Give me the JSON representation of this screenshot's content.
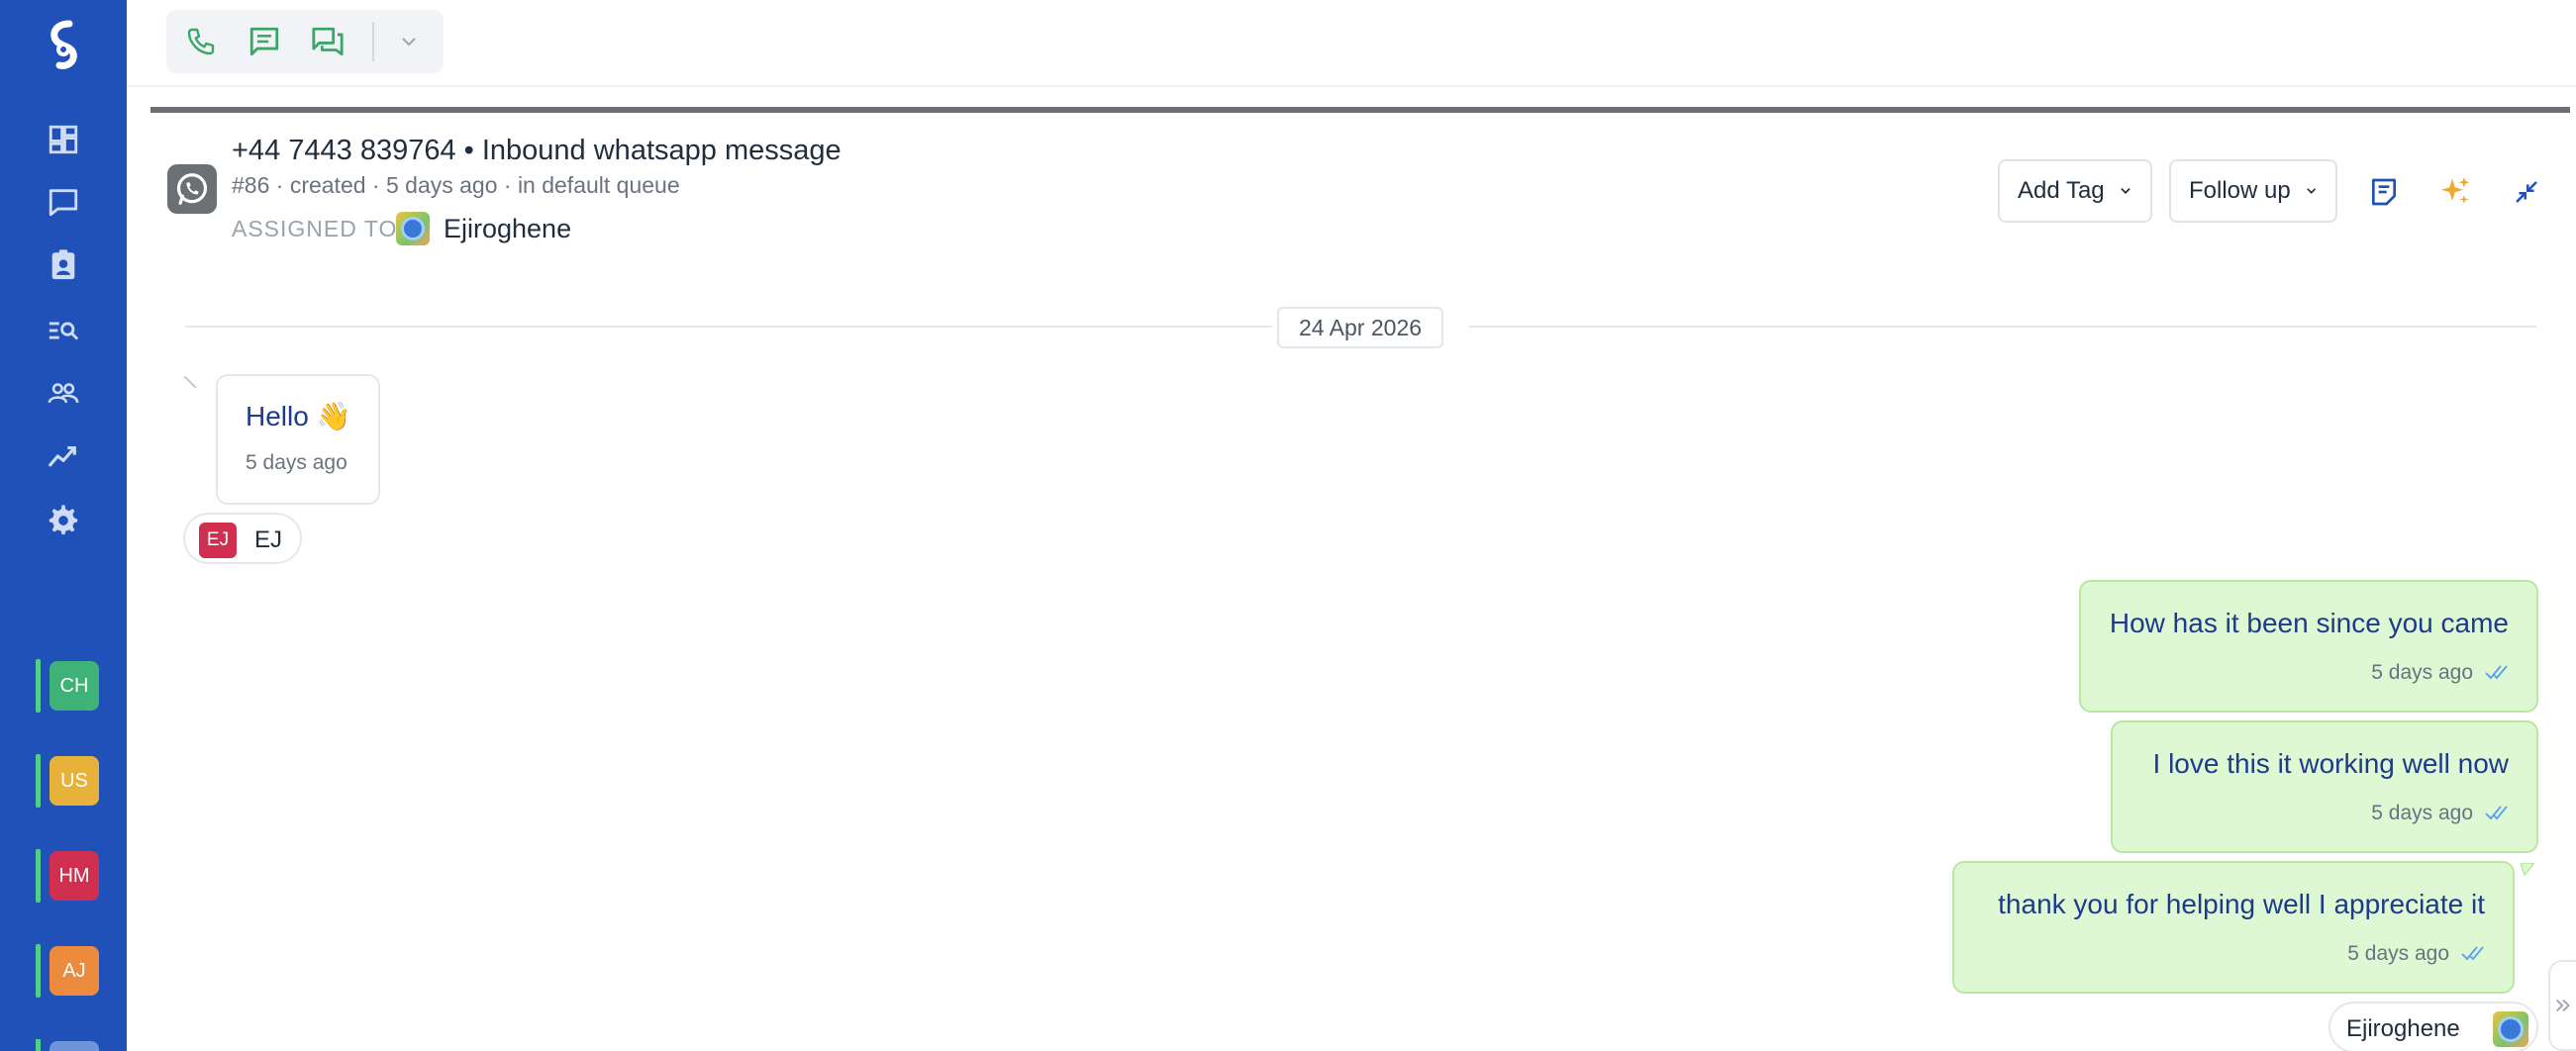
{
  "sidebar": {
    "logo": "brand-logo",
    "nav": [
      {
        "name": "dashboard-icon"
      },
      {
        "name": "chat-icon"
      },
      {
        "name": "contacts-icon"
      },
      {
        "name": "search-list-icon"
      },
      {
        "name": "team-icon"
      },
      {
        "name": "analytics-icon"
      },
      {
        "name": "gear-icon"
      }
    ],
    "inboxes": [
      {
        "initials": "CH",
        "color": "#3eb277"
      },
      {
        "initials": "US",
        "color": "#e6b23a"
      },
      {
        "initials": "HM",
        "color": "#d12f4f"
      },
      {
        "initials": "AJ",
        "color": "#ec8a3d"
      }
    ]
  },
  "toolbar": {
    "accent": "#3aa66a"
  },
  "conversation": {
    "title": "+44 7443 839764 • Inbound whatsapp message",
    "meta": "#86 · created · 5 days ago · in default queue",
    "assigned_label": "ASSIGNED TO",
    "assigned_name": "Ejiroghene",
    "add_tag_label": "Add Tag",
    "follow_up_label": "Follow up"
  },
  "thread": {
    "date": "24 Apr 2026",
    "messages": [
      {
        "direction": "in",
        "text": "Hello 👋",
        "time": "5 days ago"
      },
      {
        "direction": "out",
        "text": "How has it been since you came",
        "time": "5 days ago"
      },
      {
        "direction": "out",
        "text": "I love this it working well now",
        "time": "5 days ago"
      },
      {
        "direction": "out",
        "text": "thank you for helping well I appreciate it",
        "time": "5 days ago"
      }
    ],
    "incoming_sender": {
      "initials": "EJ",
      "name": "EJ"
    },
    "outgoing_sender": {
      "name": "Ejiroghene"
    }
  },
  "colors": {
    "sidebar_bg": "#1f51b8",
    "outgoing_bubble": "#dff8d4",
    "message_text": "#1e3a8a",
    "tick_color": "#5aa0e8",
    "sparkle": "#f0a830"
  }
}
